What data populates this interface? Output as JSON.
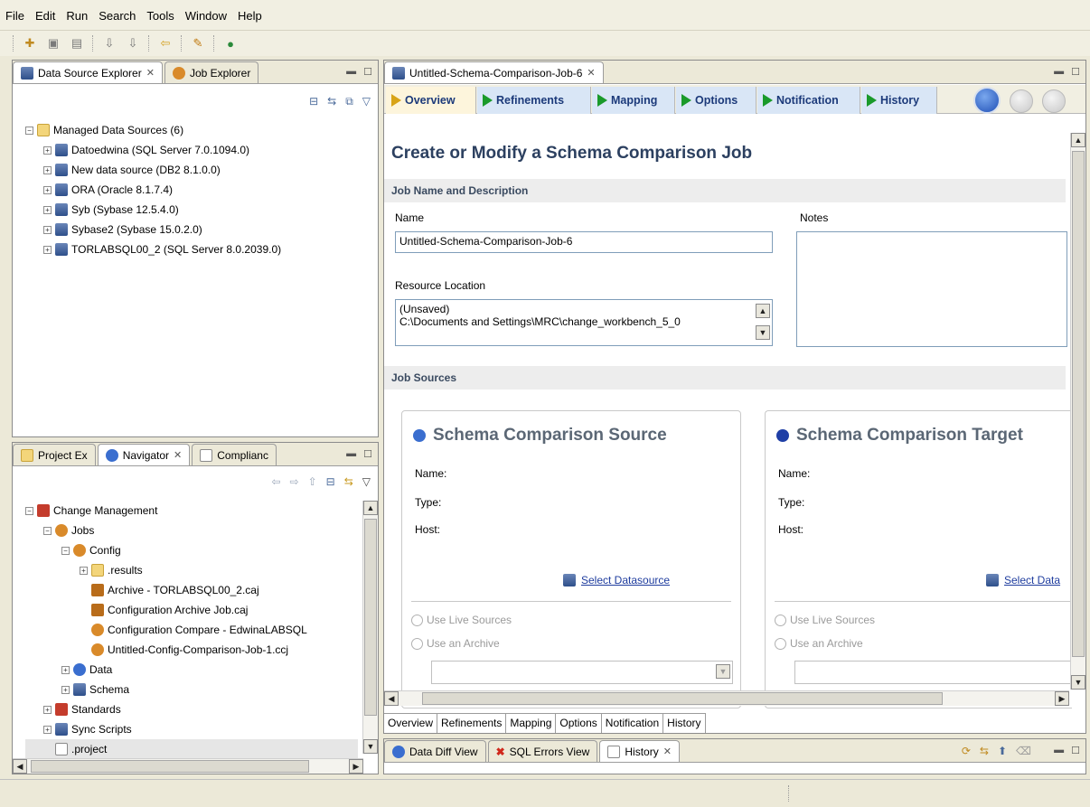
{
  "menu": [
    "File",
    "Edit",
    "Run",
    "Search",
    "Tools",
    "Window",
    "Help"
  ],
  "data_source_view": {
    "tabs": [
      {
        "label": "Data Source Explorer"
      },
      {
        "label": "Job Explorer"
      }
    ],
    "root": "Managed Data Sources (6)",
    "items": [
      "Datoedwina (SQL Server 7.0.1094.0)",
      "New data source (DB2 8.1.0.0)",
      "ORA (Oracle 8.1.7.4)",
      "Syb (Sybase 12.5.4.0)",
      "Sybase2 (Sybase 15.0.2.0)",
      "TORLABSQL00_2  (SQL Server 8.0.2039.0)"
    ]
  },
  "navigator_view": {
    "tabs": [
      {
        "label": "Project Ex"
      },
      {
        "label": "Navigator"
      },
      {
        "label": "Complianc"
      }
    ],
    "tree": [
      "Change Management",
      "Jobs",
      "Config",
      ".results",
      "Archive - TORLABSQL00_2.caj",
      "Configuration Archive Job.caj",
      "Configuration Compare - EdwinaLABSQL",
      "Untitled-Config-Comparison-Job-1.ccj",
      "Data",
      "Schema",
      "Standards",
      "Sync Scripts",
      ".project"
    ]
  },
  "editor": {
    "tab": "Untitled-Schema-Comparison-Job-6",
    "steps": [
      "Overview",
      "Refinements",
      "Mapping",
      "Options",
      "Notification",
      "History"
    ],
    "heading": "Create or Modify a Schema Comparison Job",
    "section_job": "Job Name and Description",
    "name_label": "Name",
    "name_value": "Untitled-Schema-Comparison-Job-6",
    "notes_label": "Notes",
    "resource_label": "Resource Location",
    "resource_line1": "(Unsaved)",
    "resource_line2": "C:\\Documents and Settings\\MRC\\change_workbench_5_0",
    "section_sources": "Job Sources",
    "source": {
      "title": "Schema Comparison Source",
      "name": "Name:",
      "type": "Type:",
      "host": "Host:",
      "select": "Select Datasource",
      "live": "Use Live Sources",
      "archive": "Use an Archive"
    },
    "target": {
      "title": "Schema Comparison Target",
      "name": "Name:",
      "type": "Type:",
      "host": "Host:",
      "select": "Select Data",
      "live": "Use Live Sources",
      "archive": "Use an Archive"
    },
    "bottom_tabs": [
      "Overview",
      "Refinements",
      "Mapping",
      "Options",
      "Notification",
      "History"
    ]
  },
  "lower_view": {
    "tabs": [
      {
        "label": "Data Diff View"
      },
      {
        "label": "SQL Errors View"
      },
      {
        "label": "History"
      }
    ]
  }
}
